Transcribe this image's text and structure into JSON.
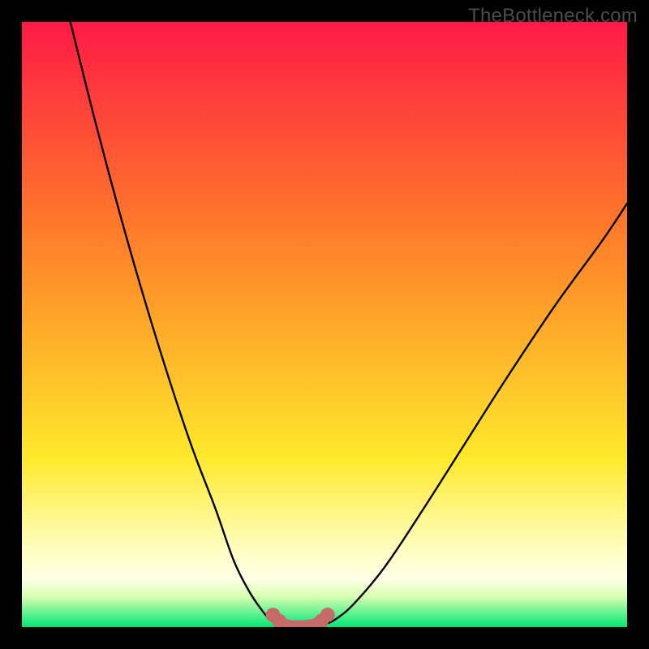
{
  "watermark": "TheBottleneck.com",
  "colors": {
    "page_bg": "#000000",
    "gradient_top": "#ff1a46",
    "gradient_mid1": "#ff7a2a",
    "gradient_mid2": "#ffe92b",
    "gradient_pale": "#ffffc9",
    "gradient_green": "#00e676",
    "curve_stroke": "#000000",
    "markers_fill": "#c76a6a",
    "markers_stroke": "#a84f4f"
  },
  "chart_data": {
    "type": "line",
    "title": "",
    "xlabel": "",
    "ylabel": "",
    "xlim": [
      0,
      100
    ],
    "ylim": [
      0,
      100
    ],
    "series": [
      {
        "name": "left-branch",
        "x": [
          8,
          12,
          16,
          20,
          24,
          28,
          32,
          35,
          37.5,
          39.5,
          41,
          42.5
        ],
        "y": [
          100,
          84,
          69,
          55,
          42,
          30,
          19.5,
          11,
          6,
          3,
          1.2,
          0.4
        ]
      },
      {
        "name": "right-branch",
        "x": [
          50,
          52,
          55,
          60,
          66,
          73,
          80,
          88,
          96,
          100
        ],
        "y": [
          0.4,
          1.4,
          4,
          10,
          19,
          30,
          41,
          53,
          64,
          70
        ]
      },
      {
        "name": "trough",
        "x": [
          42.5,
          44,
          46,
          48,
          50
        ],
        "y": [
          0.4,
          0.15,
          0.1,
          0.15,
          0.4
        ]
      }
    ],
    "markers": {
      "name": "trough-markers",
      "x": [
        41.5,
        42.5,
        43.5,
        45,
        46.5,
        48,
        49.5,
        50.5
      ],
      "y": [
        2.0,
        1.0,
        0.4,
        0.2,
        0.2,
        0.4,
        1.0,
        2.0
      ]
    },
    "gradient_bands": [
      {
        "y_from": 100,
        "y_to": 15,
        "from_color": "#ff1a46",
        "to_color": "#ffe92b"
      },
      {
        "y_from": 15,
        "y_to": 6,
        "from_color": "#ffe92b",
        "to_color": "#ffffc9"
      },
      {
        "y_from": 6,
        "y_to": 0,
        "from_color": "#ffffc9",
        "to_color": "#00e676"
      }
    ]
  }
}
